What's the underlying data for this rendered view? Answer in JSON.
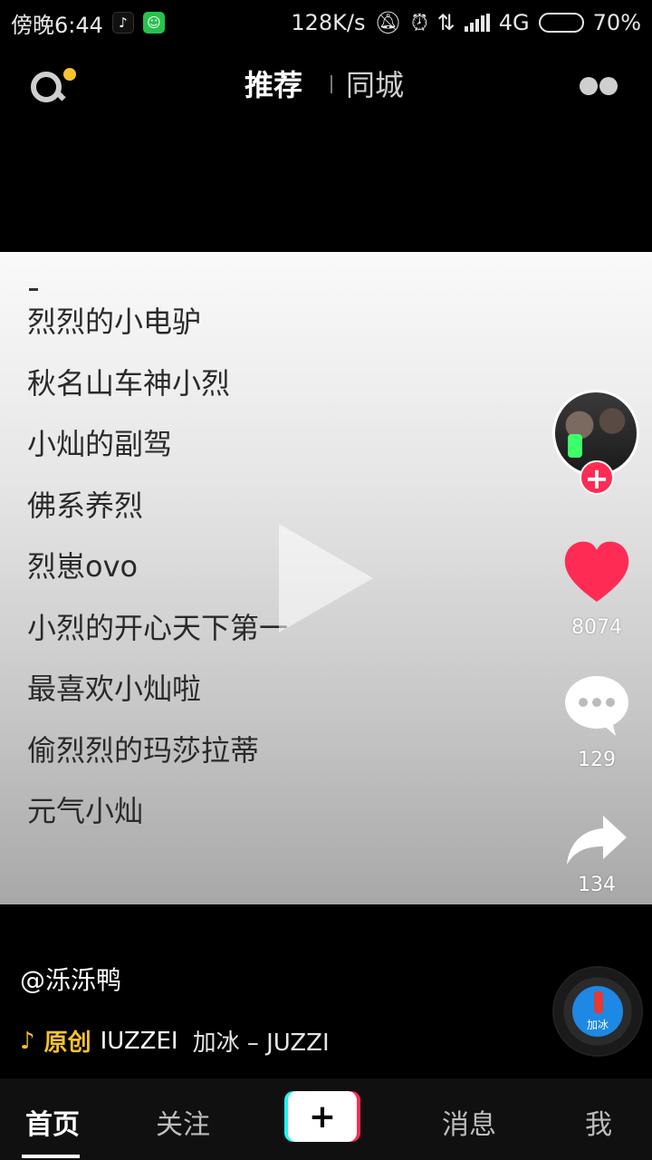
{
  "status_bar": {
    "time": "傍晚6:44",
    "speed": "128K/s",
    "network": "4G",
    "battery": "70%",
    "battery_level": 0.7
  },
  "top_nav": {
    "tab_recommend": "推荐",
    "tab_city": "同城"
  },
  "video": {
    "lines": [
      "烈烈的小电驴",
      "秋名山车神小烈",
      "小灿的副驾",
      "佛系养烈",
      "烈崽ovo",
      "小烈的开心天下第一",
      "最喜欢小灿啦",
      "偷烈烈的玛莎拉蒂",
      "元气小灿"
    ]
  },
  "rail": {
    "follow_plus": "+",
    "like_count": "8074",
    "comment_count": "129",
    "share_count": "134",
    "like_color": "#fe2c55"
  },
  "info": {
    "author": "@泺泺鸭",
    "original_label": "原创",
    "music_text": "IUZZEI",
    "song": "加冰 – JUZZI",
    "disc_label": "加冰"
  },
  "bottom_nav": {
    "home": "首页",
    "follow": "关注",
    "create": "+",
    "inbox": "消息",
    "me": "我"
  }
}
